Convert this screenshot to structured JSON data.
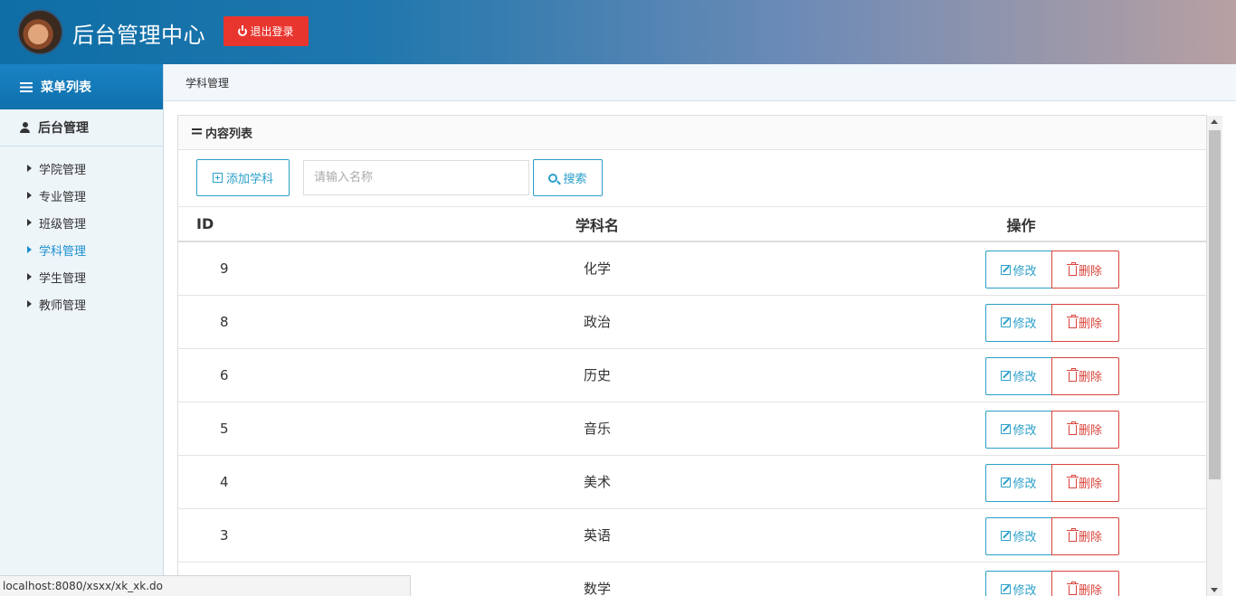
{
  "header": {
    "title": "后台管理中心",
    "logout_label": "退出登录",
    "accent": "#e8362f"
  },
  "sidebar": {
    "menu_title": "菜单列表",
    "section_title": "后台管理",
    "items": [
      {
        "label": "学院管理",
        "active": false
      },
      {
        "label": "专业管理",
        "active": false
      },
      {
        "label": "班级管理",
        "active": false
      },
      {
        "label": "学科管理",
        "active": true
      },
      {
        "label": "学生管理",
        "active": false
      },
      {
        "label": "教师管理",
        "active": false
      }
    ]
  },
  "breadcrumb": "学科管理",
  "panel": {
    "title": "内容列表",
    "add_label": "添加学科",
    "search_placeholder": "请输入名称",
    "search_label": "搜索"
  },
  "table": {
    "headers": {
      "id": "ID",
      "name": "学科名",
      "ops": "操作"
    },
    "rows": [
      {
        "id": "9",
        "name": "化学"
      },
      {
        "id": "8",
        "name": "政治"
      },
      {
        "id": "6",
        "name": "历史"
      },
      {
        "id": "5",
        "name": "音乐"
      },
      {
        "id": "4",
        "name": "美术"
      },
      {
        "id": "3",
        "name": "英语"
      },
      {
        "id": "",
        "name": "数学"
      }
    ],
    "edit_label": "修改",
    "delete_label": "删除"
  },
  "status_url": "localhost:8080/xsxx/xk_xk.do"
}
